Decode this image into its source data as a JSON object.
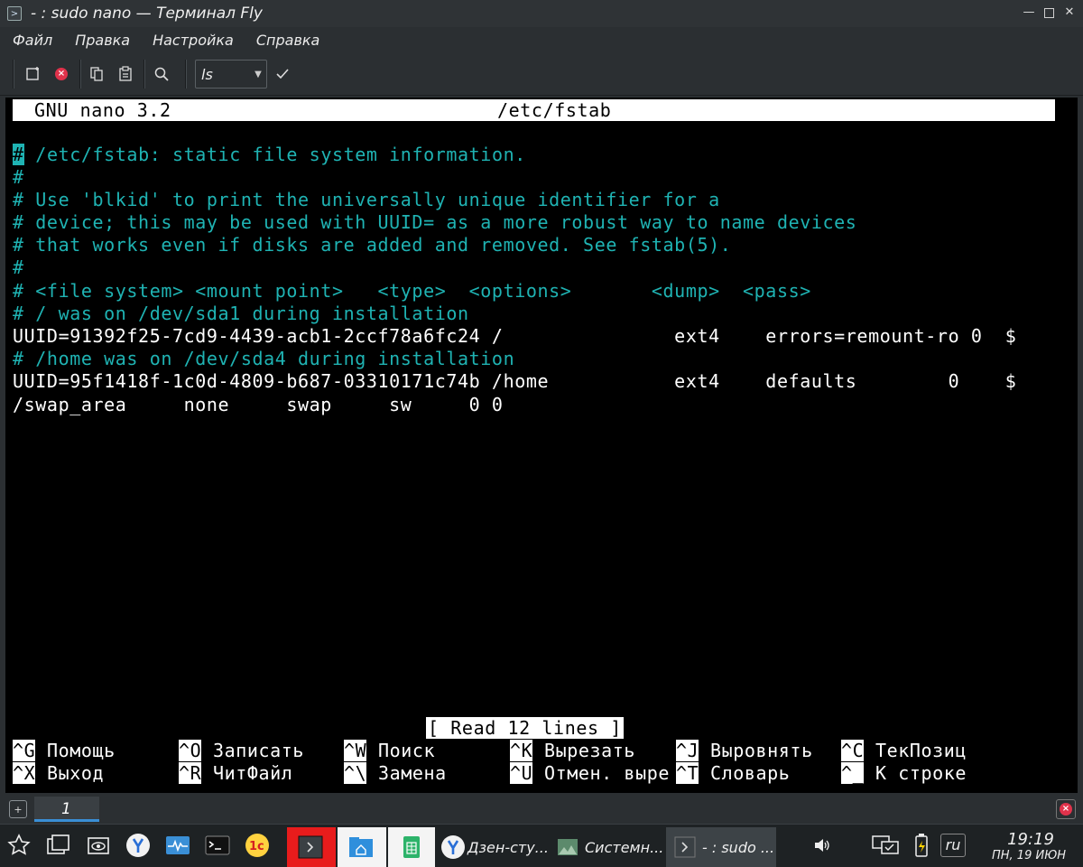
{
  "window": {
    "title": "- : sudo nano — Терминал Fly"
  },
  "menu": {
    "items": [
      "Файл",
      "Правка",
      "Настройка",
      "Справка"
    ]
  },
  "toolbar": {
    "command_value": "ls"
  },
  "nano": {
    "header_left": "GNU nano 3.2",
    "header_file": "/etc/fstab",
    "cursor_char": "#",
    "lines": [
      " /etc/fstab: static file system information.",
      "#",
      "# Use 'blkid' to print the universally unique identifier for a",
      "# device; this may be used with UUID= as a more robust way to name devices",
      "# that works even if disks are added and removed. See fstab(5).",
      "#",
      "# <file system> <mount point>   <type>  <options>       <dump>  <pass>",
      "# / was on /dev/sda1 during installation",
      "UUID=91392f25-7cd9-4439-acb1-2ccf78a6fc24 /               ext4    errors=remount-ro 0  $",
      "# /home was on /dev/sda4 during installation",
      "UUID=95f1418f-1c0d-4809-b687-03310171c74b /home           ext4    defaults        0    $",
      "/swap_area     none     swap     sw     0 0"
    ],
    "status": "[ Read 12 lines ]",
    "shortcuts_row1": [
      {
        "key": "^G",
        "label": " Помощь"
      },
      {
        "key": "^O",
        "label": " Записать"
      },
      {
        "key": "^W",
        "label": " Поиск"
      },
      {
        "key": "^K",
        "label": " Вырезать"
      },
      {
        "key": "^J",
        "label": " Выровнять"
      },
      {
        "key": "^C",
        "label": " ТекПозиц"
      }
    ],
    "shortcuts_row2": [
      {
        "key": "^X",
        "label": " Выход"
      },
      {
        "key": "^R",
        "label": " ЧитФайл"
      },
      {
        "key": "^\\",
        "label": " Замена"
      },
      {
        "key": "^U",
        "label": " Отмен. выре"
      },
      {
        "key": "^T",
        "label": " Словарь"
      },
      {
        "key": "^_",
        "label": " К строке"
      }
    ]
  },
  "tabs": {
    "active_label": "1"
  },
  "taskbar": {
    "tasks": [
      {
        "label": "Дзен-сту..."
      },
      {
        "label": "Системн..."
      },
      {
        "label": "- : sudo ..."
      }
    ],
    "lang": "ru",
    "time": "19:19",
    "date": "ПН, 19 ИЮН"
  },
  "colors": {
    "terminal_cyan": "#1fb3b3",
    "terminal_bg": "#000000",
    "tab_accent": "#3a8fd6"
  }
}
